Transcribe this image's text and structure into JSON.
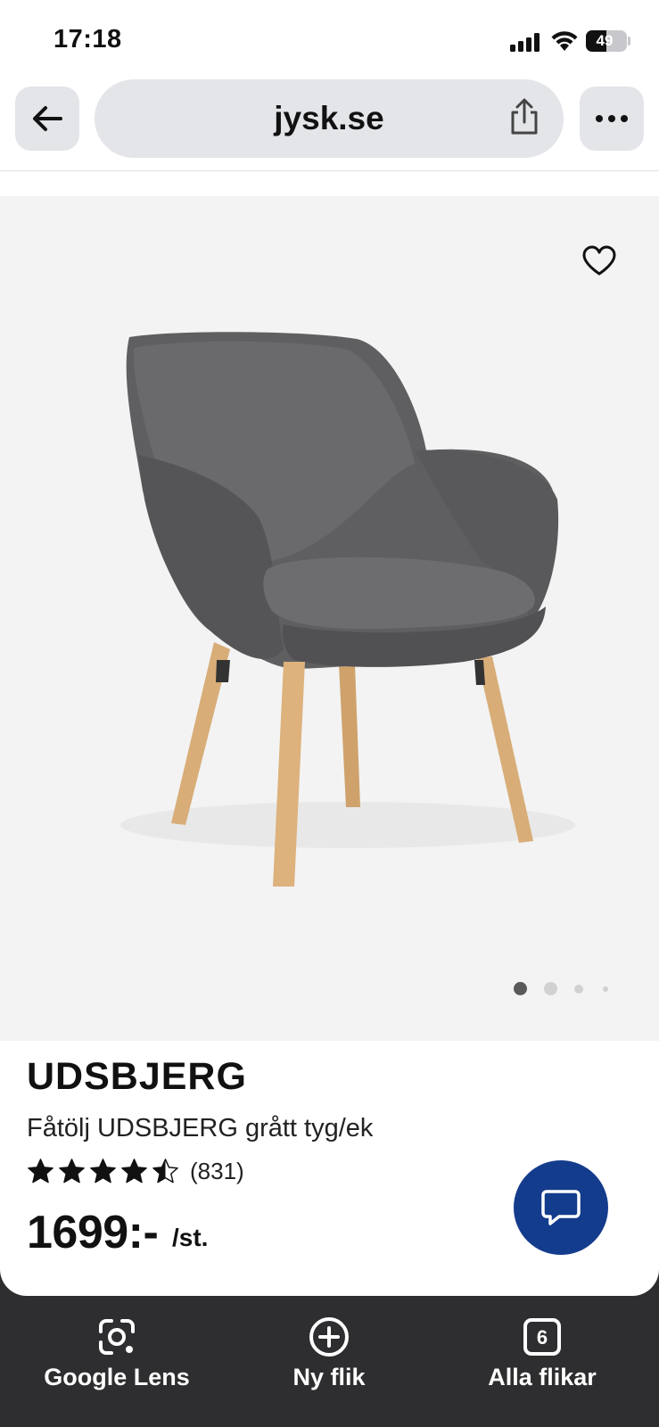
{
  "status_bar": {
    "time": "17:18",
    "battery": "49",
    "battery_level": 0.49
  },
  "browser": {
    "url": "jysk.se"
  },
  "product": {
    "brand": "UDSBJERG",
    "description": "Fåtölj UDSBJERG grått tyg/ek",
    "rating": 4.5,
    "review_count": "(831)",
    "price": "1699:-",
    "unit": "/st."
  },
  "gallery": {
    "image_count": 4,
    "current_image": 1
  },
  "toolbar": {
    "items": [
      {
        "label": "Google Lens",
        "icon": "google-lens-icon"
      },
      {
        "label": "Ny flik",
        "icon": "plus-circle-icon"
      },
      {
        "label": "Alla flikar",
        "icon": "tabs-icon",
        "count": "6"
      }
    ]
  },
  "colors": {
    "accent": "#143c8c",
    "toolbar_bg": "#2e2e30",
    "chair_fabric": "#5f5f61",
    "chair_wood": "#d8ad78",
    "image_bg": "#f3f3f3"
  }
}
